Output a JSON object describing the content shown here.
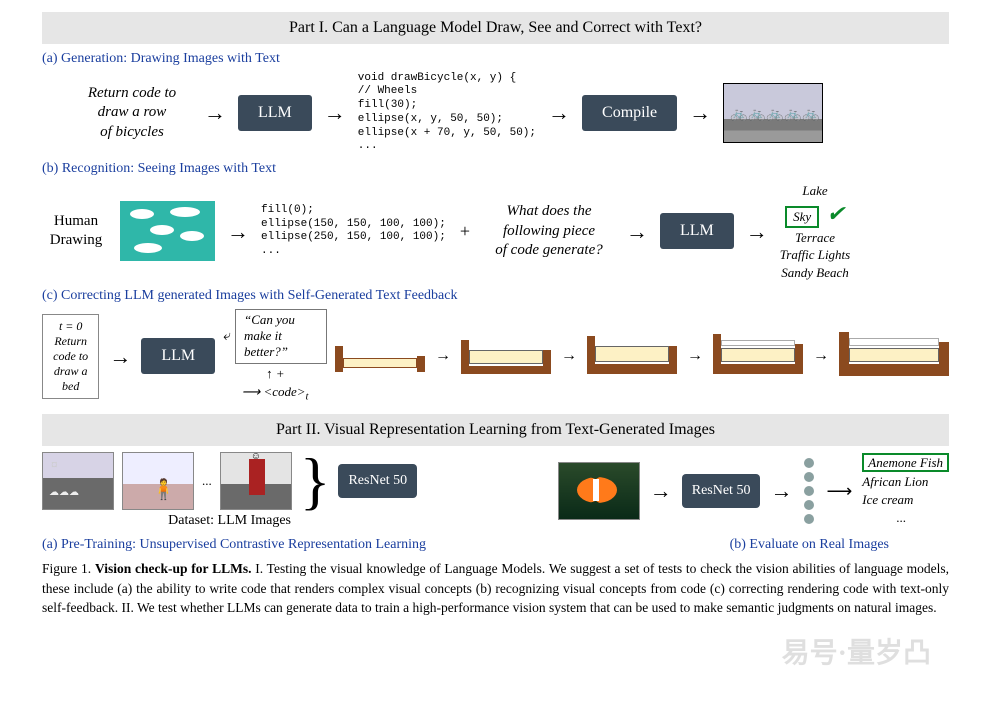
{
  "part1": {
    "banner": "Part I. Can a Language Model Draw, See and Correct with Text?",
    "a": {
      "label": "(a) Generation: Drawing Images with Text",
      "prompt": "Return code to\ndraw a row\nof bicycles",
      "llm": "LLM",
      "code": "void drawBicycle(x, y) {\n// Wheels\nfill(30);\nellipse(x, y, 50, 50);\nellipse(x + 70, y, 50, 50);\n...",
      "compile": "Compile"
    },
    "b": {
      "label": "(b) Recognition: Seeing Images with Text",
      "human_label": "Human\nDrawing",
      "code": "fill(0);\nellipse(150, 150, 100, 100);\nellipse(250, 150, 100, 100);\n...",
      "query": "What does the\nfollowing piece\nof code generate?",
      "llm": "LLM",
      "answers": [
        "Lake",
        "Sky",
        "Terrace",
        "Traffic Lights",
        "Sandy Beach"
      ],
      "correct_index": 1
    },
    "c": {
      "label": "(c) Correcting LLM generated Images with Self-Generated Text Feedback",
      "t0": "t = 0\nReturn code to\ndraw a bed",
      "llm": "LLM",
      "feedback": "“Can you make it better?”",
      "plus": "+",
      "codetok": "<code>",
      "codetok_sub": "t"
    }
  },
  "part2": {
    "banner": "Part II. Visual Representation Learning from Text-Generated Images",
    "dataset_label": "Dataset: LLM Images",
    "resnet": "ResNet 50",
    "ellipsis": "...",
    "eval_answers": [
      "Anemone Fish",
      "African Lion",
      "Ice cream"
    ],
    "eval_correct_index": 0,
    "a_label": "(a) Pre-Training: Unsupervised Contrastive Representation Learning",
    "b_label": "(b) Evaluate on Real Images"
  },
  "caption": {
    "fig": "Figure 1. ",
    "title": "Vision check-up for LLMs.",
    "body": " I. Testing the visual knowledge of Language Models. We suggest a set of tests to check the vision abilities of language models, these include (a) the ability to write code that renders complex visual concepts (b) recognizing visual concepts from code (c) correcting rendering code with text-only self-feedback. II. We test whether LLMs can generate data to train a high-performance vision system that can be used to make semantic judgments on natural images."
  },
  "watermark": "易号·量岁凸"
}
